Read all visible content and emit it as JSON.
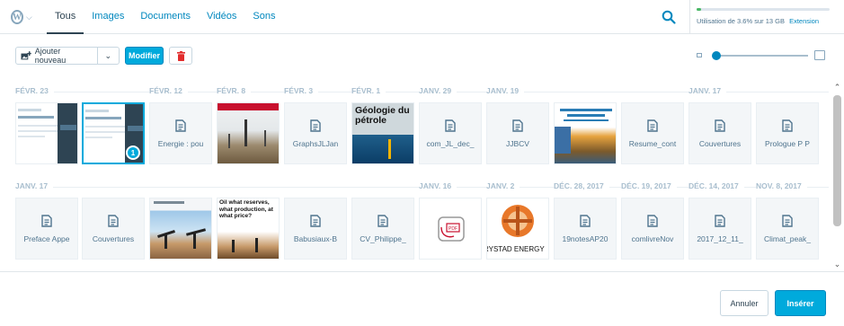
{
  "header": {
    "tabs": [
      {
        "label": "Tous",
        "active": true
      },
      {
        "label": "Images",
        "active": false
      },
      {
        "label": "Documents",
        "active": false
      },
      {
        "label": "Vidéos",
        "active": false
      },
      {
        "label": "Sons",
        "active": false
      }
    ],
    "storage": {
      "text": "Utilisation de 3.6% sur 13 GB",
      "link": "Extension",
      "used_percent": 3.6
    }
  },
  "toolbar": {
    "add_label": "Ajouter nouveau",
    "modify_label": "Modifier",
    "zoom_level_fraction": 0.0
  },
  "groups_row1": [
    {
      "label": "FÉVR. 23"
    },
    {
      "label": "FÉVR. 12"
    },
    {
      "label": "FÉVR. 8"
    },
    {
      "label": "FÉVR. 3"
    },
    {
      "label": "FÉVR. 1"
    },
    {
      "label": "JANV. 29"
    },
    {
      "label": "JANV. 19"
    },
    {
      "label": "JANV. 17"
    }
  ],
  "groups_row2": [
    {
      "label": "JANV. 17"
    },
    {
      "label": "JANV. 16"
    },
    {
      "label": "JANV. 2"
    },
    {
      "label": "DÉC. 28, 2017"
    },
    {
      "label": "DÉC. 19, 2017"
    },
    {
      "label": "DÉC. 14, 2017"
    },
    {
      "label": "NOV. 8, 2017"
    }
  ],
  "row1": [
    {
      "kind": "image",
      "icon": "screenshot-thumb"
    },
    {
      "kind": "image",
      "icon": "screenshot-thumb",
      "selected": true,
      "badge": "1"
    },
    {
      "kind": "doc",
      "name": "Energie : pou"
    },
    {
      "kind": "image",
      "icon": "oil-field-thumb"
    },
    {
      "kind": "doc",
      "name": "GraphsJLJan"
    },
    {
      "kind": "image",
      "icon": "book-cover-thumb",
      "cover_title": "Géologie du pétrole"
    },
    {
      "kind": "doc",
      "name": "com_JL_dec_"
    },
    {
      "kind": "doc",
      "name": "JJBCV"
    },
    {
      "kind": "image",
      "icon": "climate-cover-thumb"
    },
    {
      "kind": "doc",
      "name": "Resume_cont"
    },
    {
      "kind": "doc",
      "name": "Couvertures"
    },
    {
      "kind": "doc",
      "name": "Prologue P P"
    }
  ],
  "row2": [
    {
      "kind": "doc",
      "name": "Preface Appe"
    },
    {
      "kind": "doc",
      "name": "Couvertures"
    },
    {
      "kind": "image",
      "icon": "oil-pumps-thumb"
    },
    {
      "kind": "image",
      "icon": "oil-book-thumb",
      "cover_title": "Oil what reserves, what production, at what price?"
    },
    {
      "kind": "doc",
      "name": "Babusiaux-B"
    },
    {
      "kind": "doc",
      "name": "CV_Philippe_"
    },
    {
      "kind": "image",
      "icon": "pdf-file-thumb",
      "pdf_label": "PDF"
    },
    {
      "kind": "image",
      "icon": "rystad-logo-thumb",
      "brand_text": "RYSTAD ENERGY"
    },
    {
      "kind": "doc",
      "name": "19notesAP20"
    },
    {
      "kind": "doc",
      "name": "comlivreNov"
    },
    {
      "kind": "doc",
      "name": "2017_12_11_"
    },
    {
      "kind": "doc",
      "name": "Climat_peak_"
    }
  ],
  "footer": {
    "cancel_label": "Annuler",
    "insert_label": "Insérer"
  },
  "colors": {
    "accent": "#00aadc",
    "text": "#2e4453",
    "muted": "#a8bece",
    "danger": "#e22c2c"
  }
}
